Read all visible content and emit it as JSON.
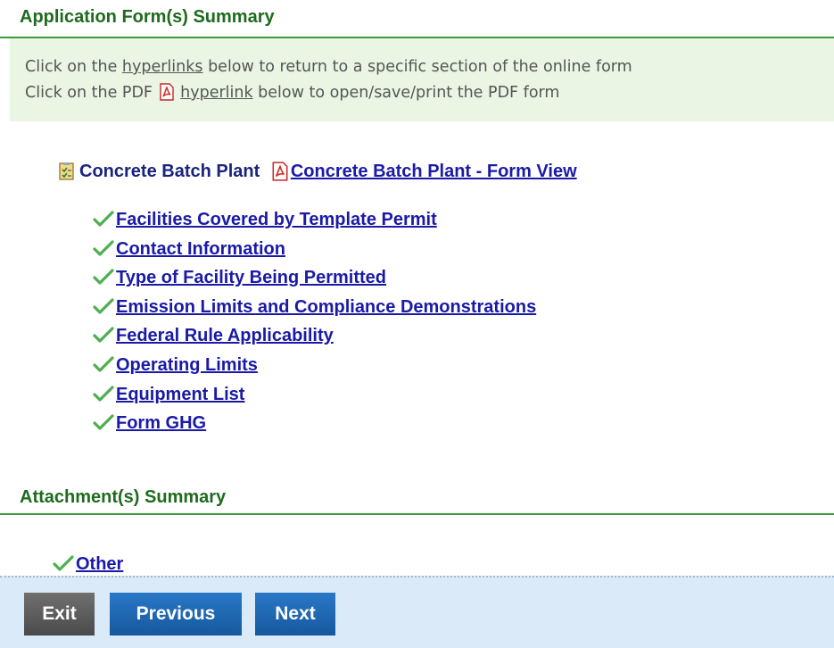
{
  "application_summary": {
    "heading": "Application Form(s) Summary",
    "instructions": {
      "line1_before": "Click on the ",
      "line1_link": "hyperlinks",
      "line1_after": " below to return to a specific section of the online form",
      "line2_before": "Click on the PDF ",
      "line2_link": "hyperlink",
      "line2_after": " below to open/save/print the PDF form"
    },
    "form": {
      "name": "Concrete Batch Plant",
      "pdf_link": "Concrete Batch Plant - Form View",
      "form_icon": "form-document-icon",
      "pdf_icon": "pdf-icon"
    },
    "sections": [
      {
        "label": "Facilities Covered by Template Permit",
        "status": "complete"
      },
      {
        "label": "Contact Information",
        "status": "complete"
      },
      {
        "label": "Type of Facility Being Permitted",
        "status": "complete"
      },
      {
        "label": "Emission Limits and Compliance Demonstrations",
        "status": "complete"
      },
      {
        "label": "Federal Rule Applicability",
        "status": "complete"
      },
      {
        "label": "Operating Limits",
        "status": "complete"
      },
      {
        "label": "Equipment List",
        "status": "complete"
      },
      {
        "label": "Form GHG",
        "status": "complete"
      }
    ]
  },
  "attachment_summary": {
    "heading": "Attachment(s) Summary",
    "items": [
      {
        "label": "Other",
        "status": "complete"
      }
    ]
  },
  "footer": {
    "exit_label": "Exit",
    "previous_label": "Previous",
    "next_label": "Next"
  },
  "colors": {
    "heading_green": "#1e6b1e",
    "info_bg": "#ebf5e4",
    "link_blue": "#1a1aa6",
    "check_green": "#4caf50",
    "button_blue": "#1f68b4",
    "button_gray": "#5a5a5a",
    "footer_bg": "#daeaf8"
  }
}
